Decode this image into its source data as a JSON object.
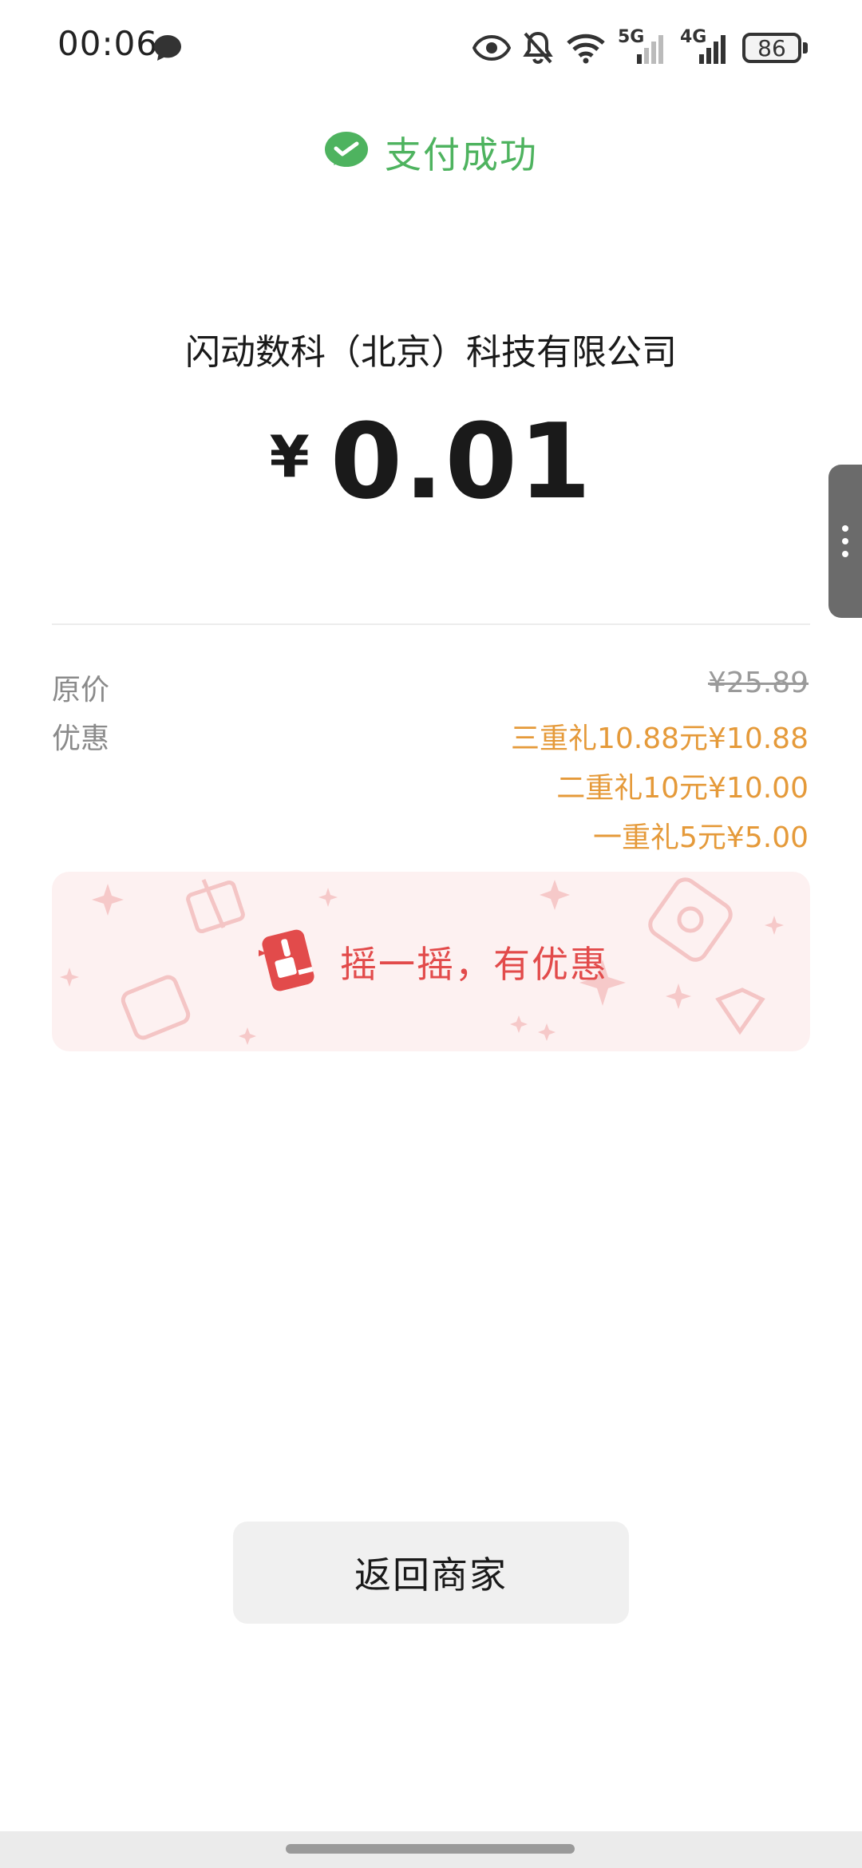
{
  "status_bar": {
    "time": "00:06",
    "network_5g": "5G",
    "network_4g": "4G",
    "battery": "86",
    "icons": [
      "message-bubble-icon",
      "eye-icon",
      "bell-off-icon",
      "wifi-icon",
      "signal-5g-icon",
      "signal-4g-icon",
      "battery-icon"
    ]
  },
  "header": {
    "title": "支付成功",
    "icon": "wechat-pay-check-icon",
    "accent_color": "#4eb35f"
  },
  "payment": {
    "merchant": "闪动数科（北京）科技有限公司",
    "currency_symbol": "¥",
    "amount": "0.01"
  },
  "details": {
    "original_price_label": "原价",
    "original_price_value": "¥25.89",
    "discount_label": "优惠",
    "discounts": [
      {
        "text": "三重礼10.88元¥10.88"
      },
      {
        "text": "二重礼10元¥10.00"
      },
      {
        "text": "一重礼5元¥5.00"
      }
    ],
    "discount_color": "#e59a3a"
  },
  "promo": {
    "text": "摇一摇，有优惠",
    "icon": "shake-phone-icon",
    "text_color": "#e24b4b",
    "background": "#fdf1f1"
  },
  "actions": {
    "return_label": "返回商家"
  }
}
